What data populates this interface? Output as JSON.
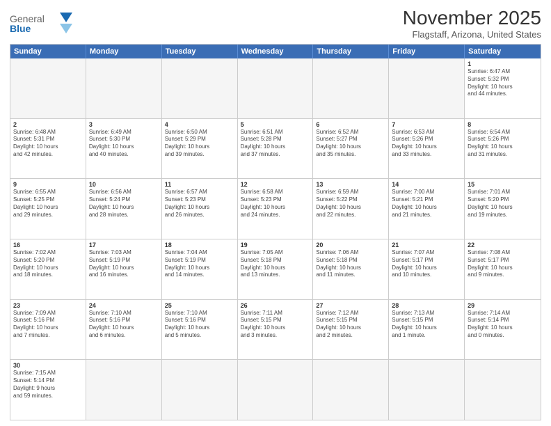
{
  "header": {
    "logo": {
      "general": "General",
      "blue": "Blue"
    },
    "title": "November 2025",
    "location": "Flagstaff, Arizona, United States"
  },
  "calendar": {
    "days_of_week": [
      "Sunday",
      "Monday",
      "Tuesday",
      "Wednesday",
      "Thursday",
      "Friday",
      "Saturday"
    ],
    "rows": [
      [
        {
          "day": "",
          "empty": true
        },
        {
          "day": "",
          "empty": true
        },
        {
          "day": "",
          "empty": true
        },
        {
          "day": "",
          "empty": true
        },
        {
          "day": "",
          "empty": true
        },
        {
          "day": "",
          "empty": true
        },
        {
          "day": "1",
          "info": "Sunrise: 6:47 AM\nSunset: 5:32 PM\nDaylight: 10 hours\nand 44 minutes."
        }
      ],
      [
        {
          "day": "2",
          "info": "Sunrise: 6:48 AM\nSunset: 5:31 PM\nDaylight: 10 hours\nand 42 minutes."
        },
        {
          "day": "3",
          "info": "Sunrise: 6:49 AM\nSunset: 5:30 PM\nDaylight: 10 hours\nand 40 minutes."
        },
        {
          "day": "4",
          "info": "Sunrise: 6:50 AM\nSunset: 5:29 PM\nDaylight: 10 hours\nand 39 minutes."
        },
        {
          "day": "5",
          "info": "Sunrise: 6:51 AM\nSunset: 5:28 PM\nDaylight: 10 hours\nand 37 minutes."
        },
        {
          "day": "6",
          "info": "Sunrise: 6:52 AM\nSunset: 5:27 PM\nDaylight: 10 hours\nand 35 minutes."
        },
        {
          "day": "7",
          "info": "Sunrise: 6:53 AM\nSunset: 5:26 PM\nDaylight: 10 hours\nand 33 minutes."
        },
        {
          "day": "8",
          "info": "Sunrise: 6:54 AM\nSunset: 5:26 PM\nDaylight: 10 hours\nand 31 minutes."
        }
      ],
      [
        {
          "day": "9",
          "info": "Sunrise: 6:55 AM\nSunset: 5:25 PM\nDaylight: 10 hours\nand 29 minutes."
        },
        {
          "day": "10",
          "info": "Sunrise: 6:56 AM\nSunset: 5:24 PM\nDaylight: 10 hours\nand 28 minutes."
        },
        {
          "day": "11",
          "info": "Sunrise: 6:57 AM\nSunset: 5:23 PM\nDaylight: 10 hours\nand 26 minutes."
        },
        {
          "day": "12",
          "info": "Sunrise: 6:58 AM\nSunset: 5:23 PM\nDaylight: 10 hours\nand 24 minutes."
        },
        {
          "day": "13",
          "info": "Sunrise: 6:59 AM\nSunset: 5:22 PM\nDaylight: 10 hours\nand 22 minutes."
        },
        {
          "day": "14",
          "info": "Sunrise: 7:00 AM\nSunset: 5:21 PM\nDaylight: 10 hours\nand 21 minutes."
        },
        {
          "day": "15",
          "info": "Sunrise: 7:01 AM\nSunset: 5:20 PM\nDaylight: 10 hours\nand 19 minutes."
        }
      ],
      [
        {
          "day": "16",
          "info": "Sunrise: 7:02 AM\nSunset: 5:20 PM\nDaylight: 10 hours\nand 18 minutes."
        },
        {
          "day": "17",
          "info": "Sunrise: 7:03 AM\nSunset: 5:19 PM\nDaylight: 10 hours\nand 16 minutes."
        },
        {
          "day": "18",
          "info": "Sunrise: 7:04 AM\nSunset: 5:19 PM\nDaylight: 10 hours\nand 14 minutes."
        },
        {
          "day": "19",
          "info": "Sunrise: 7:05 AM\nSunset: 5:18 PM\nDaylight: 10 hours\nand 13 minutes."
        },
        {
          "day": "20",
          "info": "Sunrise: 7:06 AM\nSunset: 5:18 PM\nDaylight: 10 hours\nand 11 minutes."
        },
        {
          "day": "21",
          "info": "Sunrise: 7:07 AM\nSunset: 5:17 PM\nDaylight: 10 hours\nand 10 minutes."
        },
        {
          "day": "22",
          "info": "Sunrise: 7:08 AM\nSunset: 5:17 PM\nDaylight: 10 hours\nand 9 minutes."
        }
      ],
      [
        {
          "day": "23",
          "info": "Sunrise: 7:09 AM\nSunset: 5:16 PM\nDaylight: 10 hours\nand 7 minutes."
        },
        {
          "day": "24",
          "info": "Sunrise: 7:10 AM\nSunset: 5:16 PM\nDaylight: 10 hours\nand 6 minutes."
        },
        {
          "day": "25",
          "info": "Sunrise: 7:10 AM\nSunset: 5:16 PM\nDaylight: 10 hours\nand 5 minutes."
        },
        {
          "day": "26",
          "info": "Sunrise: 7:11 AM\nSunset: 5:15 PM\nDaylight: 10 hours\nand 3 minutes."
        },
        {
          "day": "27",
          "info": "Sunrise: 7:12 AM\nSunset: 5:15 PM\nDaylight: 10 hours\nand 2 minutes."
        },
        {
          "day": "28",
          "info": "Sunrise: 7:13 AM\nSunset: 5:15 PM\nDaylight: 10 hours\nand 1 minute."
        },
        {
          "day": "29",
          "info": "Sunrise: 7:14 AM\nSunset: 5:14 PM\nDaylight: 10 hours\nand 0 minutes."
        }
      ],
      [
        {
          "day": "30",
          "info": "Sunrise: 7:15 AM\nSunset: 5:14 PM\nDaylight: 9 hours\nand 59 minutes."
        },
        {
          "day": "",
          "empty": true
        },
        {
          "day": "",
          "empty": true
        },
        {
          "day": "",
          "empty": true
        },
        {
          "day": "",
          "empty": true
        },
        {
          "day": "",
          "empty": true
        },
        {
          "day": "",
          "empty": true
        }
      ]
    ]
  }
}
